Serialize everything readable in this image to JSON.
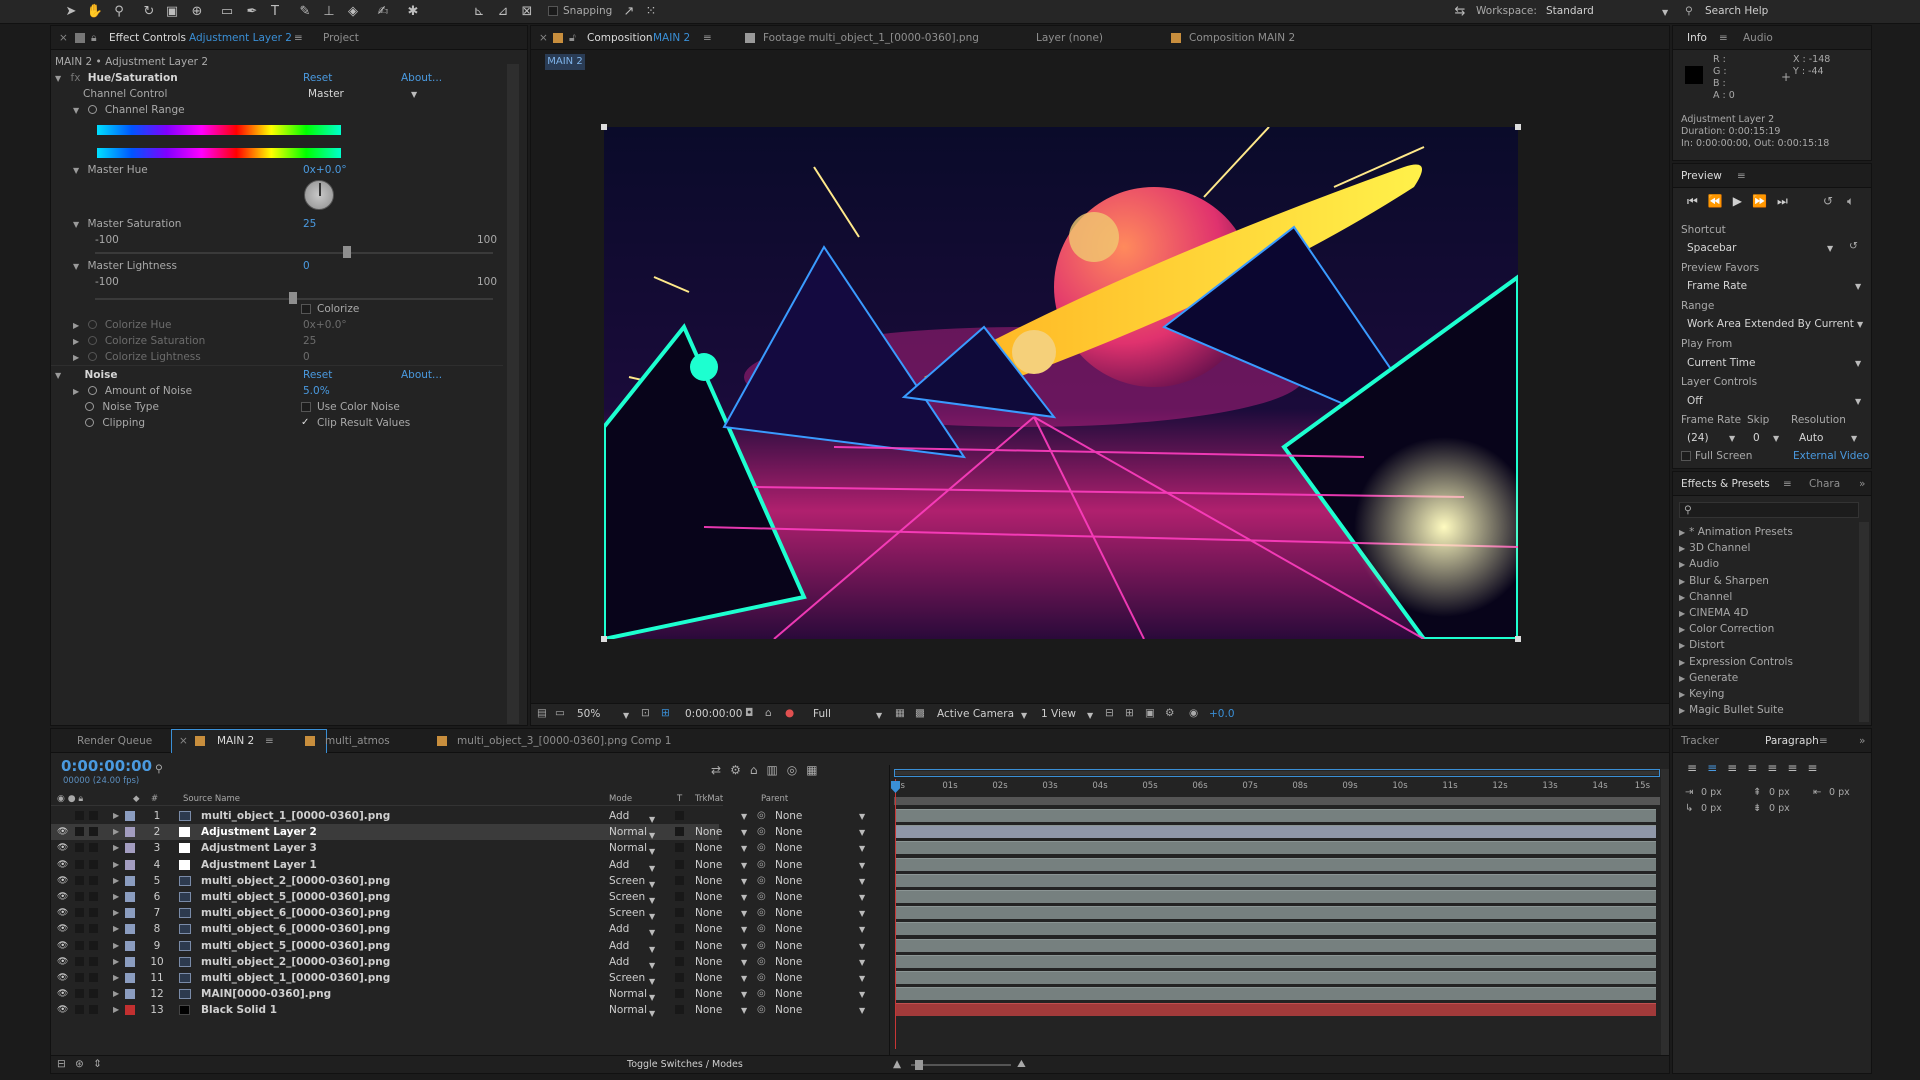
{
  "toolbar": {
    "snapping_label": "Snapping",
    "workspace_label": "Workspace:",
    "workspace_value": "Standard",
    "search_help": "Search Help"
  },
  "effect_controls": {
    "tab_label": "Effect Controls",
    "tab_layer": "Adjustment Layer 2",
    "project_tab": "Project",
    "breadcrumb": "MAIN 2 • Adjustment Layer 2",
    "hue_saturation": {
      "name": "Hue/Saturation",
      "reset": "Reset",
      "about": "About...",
      "channel_control_label": "Channel Control",
      "channel_control_value": "Master",
      "channel_range_label": "Channel Range",
      "master_hue_label": "Master Hue",
      "master_hue_value": "0x+0.0°",
      "master_saturation_label": "Master Saturation",
      "master_saturation_value": "25",
      "sat_min": "-100",
      "sat_max": "100",
      "saturation_level_fraction": 0.5,
      "master_lightness_label": "Master Lightness",
      "master_lightness_value": "0",
      "light_min": "-100",
      "light_max": "100",
      "lightness_level_fraction": 0.5,
      "colorize_label": "Colorize",
      "colorize_hue_label": "Colorize Hue",
      "colorize_hue_value": "0x+0.0°",
      "colorize_saturation_label": "Colorize Saturation",
      "colorize_saturation_value": "25",
      "colorize_lightness_label": "Colorize Lightness",
      "colorize_lightness_value": "0"
    },
    "noise": {
      "name": "Noise",
      "reset": "Reset",
      "about": "About...",
      "amount_label": "Amount of Noise",
      "amount_value": "5.0%",
      "type_label": "Noise Type",
      "use_color_noise": "Use Color Noise",
      "clipping_label": "Clipping",
      "clip_result": "Clip Result Values"
    }
  },
  "composition": {
    "tab_label": "Composition",
    "tab_comp": "MAIN 2",
    "footage_tab": "Footage multi_object_1_[0000-0360].png",
    "layer_tab": "Layer (none)",
    "comp_tab2": "Composition MAIN 2",
    "subtab": "MAIN 2",
    "zoom": "50%",
    "timecode": "0:00:00:00",
    "resolution": "Full",
    "camera": "Active Camera",
    "views": "1 View",
    "exposure": "+0.0"
  },
  "info": {
    "tab": "Info",
    "audio_tab": "Audio",
    "r": "R :",
    "g": "G :",
    "b": "B :",
    "a": "A : 0",
    "x": "X : -148",
    "y": "Y : -44",
    "layer_name": "Adjustment Layer 2",
    "duration": "Duration: 0:00:15:19",
    "in_out": "In: 0:00:00:00, Out: 0:00:15:18"
  },
  "preview": {
    "title": "Preview",
    "shortcut_label": "Shortcut",
    "shortcut_value": "Spacebar",
    "favors_label": "Preview Favors",
    "favors_value": "Frame Rate",
    "range_label": "Range",
    "range_value": "Work Area Extended By Current Ti",
    "play_from_label": "Play From",
    "play_from_value": "Current Time",
    "layer_controls_label": "Layer Controls",
    "layer_controls_value": "Off",
    "frame_rate_label": "Frame Rate",
    "skip_label": "Skip",
    "resolution_label": "Resolution",
    "frame_rate_value": "(24)",
    "skip_value": "0",
    "resolution_value": "Auto",
    "full_screen": "Full Screen",
    "external_video": "External Video"
  },
  "effects_presets": {
    "tab": "Effects & Presets",
    "char_tab": "Chara",
    "items": [
      "* Animation Presets",
      "3D Channel",
      "Audio",
      "Blur & Sharpen",
      "Channel",
      "CINEMA 4D",
      "Color Correction",
      "Distort",
      "Expression Controls",
      "Generate",
      "Keying",
      "Magic Bullet Suite"
    ]
  },
  "timeline": {
    "render_queue": "Render Queue",
    "main_tab": "MAIN 2",
    "tab2": "multi_atmos",
    "tab3": "multi_object_3_[0000-0360].png Comp 1",
    "timecode": "0:00:00:00",
    "frame_info": "00000 (24.00 fps)",
    "col_num": "#",
    "col_source": "Source Name",
    "col_mode": "Mode",
    "col_t": "T",
    "col_trkmat": "TrkMat",
    "col_parent": "Parent",
    "toggle": "Toggle Switches / Modes",
    "ruler": [
      "0s",
      "01s",
      "02s",
      "03s",
      "04s",
      "05s",
      "06s",
      "07s",
      "08s",
      "09s",
      "10s",
      "11s",
      "12s",
      "13s",
      "14s",
      "15s"
    ],
    "layers": [
      {
        "num": "1",
        "name": "multi_object_1_[0000-0360].png",
        "mode": "Add",
        "trkmat": "",
        "parent": "None",
        "type": "footage",
        "label": "#8b9dc0",
        "eye": false
      },
      {
        "num": "2",
        "name": "Adjustment Layer 2",
        "mode": "Normal",
        "trkmat": "None",
        "parent": "None",
        "type": "solid-white",
        "label": "#a39dc0",
        "eye": true,
        "selected": true
      },
      {
        "num": "3",
        "name": "Adjustment Layer 3",
        "mode": "Normal",
        "trkmat": "None",
        "parent": "None",
        "type": "solid-white",
        "label": "#a39dc0",
        "eye": true
      },
      {
        "num": "4",
        "name": "Adjustment Layer 1",
        "mode": "Add",
        "trkmat": "None",
        "parent": "None",
        "type": "solid-white",
        "label": "#a39dc0",
        "eye": true
      },
      {
        "num": "5",
        "name": "multi_object_2_[0000-0360].png",
        "mode": "Screen",
        "trkmat": "None",
        "parent": "None",
        "type": "footage",
        "label": "#8b9dc0",
        "eye": true
      },
      {
        "num": "6",
        "name": "multi_object_5_[0000-0360].png",
        "mode": "Screen",
        "trkmat": "None",
        "parent": "None",
        "type": "footage",
        "label": "#8b9dc0",
        "eye": true
      },
      {
        "num": "7",
        "name": "multi_object_6_[0000-0360].png",
        "mode": "Screen",
        "trkmat": "None",
        "parent": "None",
        "type": "footage",
        "label": "#8b9dc0",
        "eye": true
      },
      {
        "num": "8",
        "name": "multi_object_6_[0000-0360].png",
        "mode": "Add",
        "trkmat": "None",
        "parent": "None",
        "type": "footage",
        "label": "#8b9dc0",
        "eye": true
      },
      {
        "num": "9",
        "name": "multi_object_5_[0000-0360].png",
        "mode": "Add",
        "trkmat": "None",
        "parent": "None",
        "type": "footage",
        "label": "#8b9dc0",
        "eye": true
      },
      {
        "num": "10",
        "name": "multi_object_2_[0000-0360].png",
        "mode": "Add",
        "trkmat": "None",
        "parent": "None",
        "type": "footage",
        "label": "#8b9dc0",
        "eye": true
      },
      {
        "num": "11",
        "name": "multi_object_1_[0000-0360].png",
        "mode": "Screen",
        "trkmat": "None",
        "parent": "None",
        "type": "footage",
        "label": "#8b9dc0",
        "eye": true
      },
      {
        "num": "12",
        "name": "MAIN[0000-0360].png",
        "mode": "Normal",
        "trkmat": "None",
        "parent": "None",
        "type": "footage",
        "label": "#8b9dc0",
        "eye": true
      },
      {
        "num": "13",
        "name": "Black Solid 1",
        "mode": "Normal",
        "trkmat": "None",
        "parent": "None",
        "type": "solid-black",
        "label": "#c23030",
        "eye": true
      }
    ]
  },
  "paragraph": {
    "tracker_tab": "Tracker",
    "paragraph_tab": "Paragraph",
    "px1": "0 px",
    "px2": "0 px",
    "px3": "0 px",
    "px4": "0 px",
    "px5": "0 px"
  },
  "colors": {
    "accent": "#3a8fd6",
    "selection": "#3b3b3b",
    "playhead": "#c83636"
  }
}
